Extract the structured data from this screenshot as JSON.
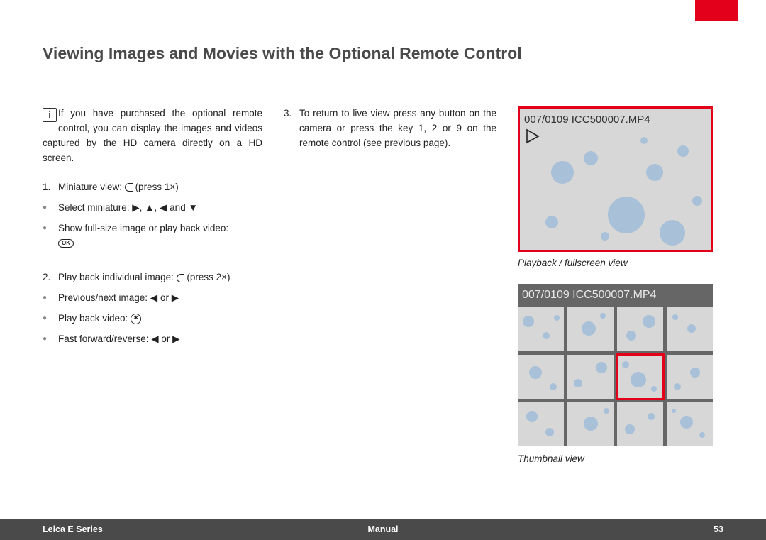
{
  "heading": "Viewing Images and Movies with the Optional Remote Control",
  "intro": "If you have purchased the optional remote control, you can display the images and videos captured by the HD camera directly on a HD screen.",
  "col1": {
    "step1_num": "1.",
    "step1": "Miniature view: ",
    "step1_suffix": "(press 1×)",
    "b1": "Select miniature: ▶, ▲, ◀ and ▼",
    "b2": "Show full-size image or play back video:",
    "step2_num": "2.",
    "step2": "Play back individual image: ",
    "step2_suffix": "(press 2×)",
    "b3": "Previous/next image: ◀ or ▶",
    "b4": "Play back video: ",
    "b5": "Fast forward/reverse: ◀ or ▶"
  },
  "col2": {
    "step3_num": "3.",
    "step3": "To return to live view press any button on the camera or press the key 1, 2 or 9 on the remote control (see previous page)."
  },
  "fig": {
    "overlay": "007/0109 ICC500007.MP4",
    "cap1": "Playback / fullscreen view",
    "cap2": "Thumbnail view"
  },
  "footer": {
    "left": "Leica E Series",
    "center": "Manual",
    "right": "53"
  },
  "icons": {
    "ok": "OK"
  }
}
